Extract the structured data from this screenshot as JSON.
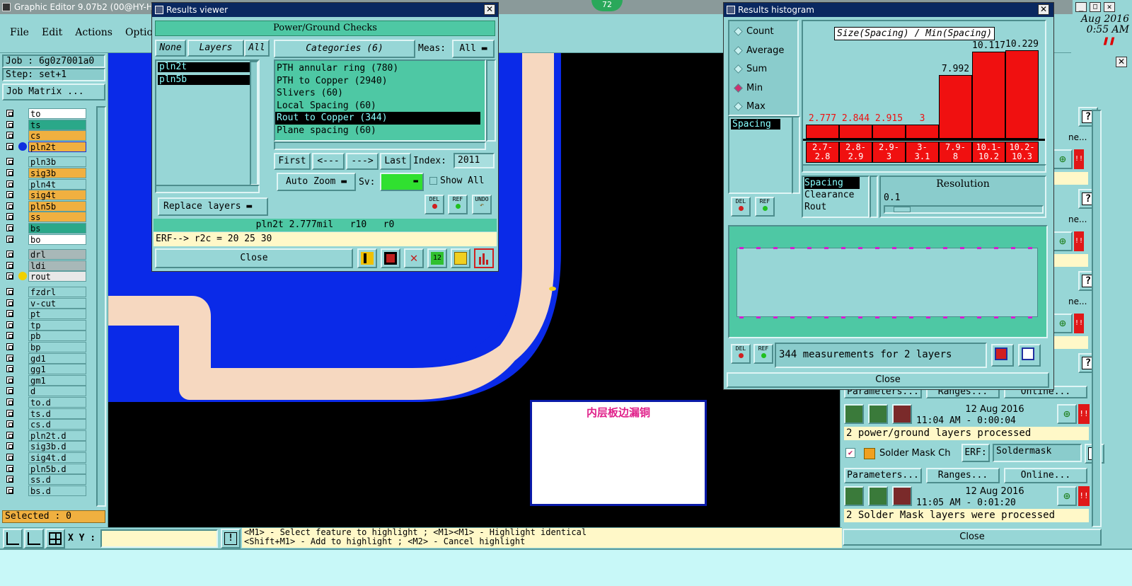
{
  "app": {
    "title": "Graphic Editor 9.07b2 (00@HY-HYC",
    "badge": "72",
    "clock": {
      "date": "Aug 2016",
      "time": "0:55 AM"
    }
  },
  "menu": {
    "items": [
      "File",
      "Edit",
      "Actions",
      "Options"
    ]
  },
  "job": {
    "label": "Job : 6g0z7001a0",
    "step": "Step: set+1",
    "matrix_button": "Job Matrix ...",
    "selected": "Selected : 0"
  },
  "layers": [
    {
      "name": "to",
      "color": "#ffffff"
    },
    {
      "name": "ts",
      "color": "#2aa889"
    },
    {
      "name": "cs",
      "color": "#f0b040"
    },
    {
      "name": "pln2t",
      "color": "#f0b040",
      "active": true
    },
    {
      "name": "pln3b",
      "color": "#97d6d6"
    },
    {
      "name": "sig3b",
      "color": "#f0b040"
    },
    {
      "name": "pln4t",
      "color": "#97d6d6"
    },
    {
      "name": "sig4t",
      "color": "#f0b040"
    },
    {
      "name": "pln5b",
      "color": "#f0b040"
    },
    {
      "name": "ss",
      "color": "#f0b040"
    },
    {
      "name": "bs",
      "color": "#2aa889"
    },
    {
      "name": "bo",
      "color": "#ffffff"
    },
    {
      "name": "drl",
      "color": "#a8b8b8"
    },
    {
      "name": "ldi",
      "color": "#a8b8b8"
    },
    {
      "name": "rout",
      "color": "#e8e8e8",
      "dot": true
    },
    {
      "name": "fzdrl",
      "color": "#97d6d6"
    },
    {
      "name": "v-cut",
      "color": "#97d6d6"
    },
    {
      "name": "pt",
      "color": "#97d6d6"
    },
    {
      "name": "tp",
      "color": "#97d6d6"
    },
    {
      "name": "pb",
      "color": "#97d6d6"
    },
    {
      "name": "bp",
      "color": "#97d6d6"
    },
    {
      "name": "gd1",
      "color": "#97d6d6"
    },
    {
      "name": "gg1",
      "color": "#97d6d6"
    },
    {
      "name": "gm1",
      "color": "#97d6d6"
    },
    {
      "name": "d",
      "color": "#97d6d6"
    },
    {
      "name": "to.d",
      "color": "#97d6d6"
    },
    {
      "name": "ts.d",
      "color": "#97d6d6"
    },
    {
      "name": "cs.d",
      "color": "#97d6d6"
    },
    {
      "name": "pln2t.d",
      "color": "#97d6d6"
    },
    {
      "name": "sig3b.d",
      "color": "#97d6d6"
    },
    {
      "name": "sig4t.d",
      "color": "#97d6d6"
    },
    {
      "name": "pln5b.d",
      "color": "#97d6d6"
    },
    {
      "name": "ss.d",
      "color": "#97d6d6"
    },
    {
      "name": "bs.d",
      "color": "#97d6d6"
    }
  ],
  "results_viewer": {
    "title": "Results viewer",
    "header": "Power/Ground Checks",
    "layers_toggle": {
      "none": "None",
      "layers": "Layers",
      "all": "All"
    },
    "layer_list": [
      "pln2t",
      "pln5b"
    ],
    "categories_label": "Categories (6)",
    "meas_label": "Meas:",
    "meas_value": "All",
    "categories": [
      "PTH annular ring (780)",
      "PTH to Copper (2940)",
      "Slivers (60)",
      "Local Spacing (60)",
      "Rout to Copper (344)",
      "Plane spacing (60)"
    ],
    "selected_category": "Rout to Copper (344)",
    "nav": {
      "first": "First",
      "prev": "<---",
      "next": "--->",
      "last": "Last",
      "index_label": "Index:",
      "index_value": "2011"
    },
    "auto_zoom": "Auto Zoom",
    "sv_label": "Sv:",
    "show_all": "Show All",
    "replace_layers": "Replace layers",
    "icon_labels": {
      "del": "DEL",
      "ref": "REF",
      "undo": "UNDO"
    },
    "status": "pln2t 2.777mil   r10   r0",
    "erf": "ERF--> r2c = 20 25 30",
    "close": "Close"
  },
  "histogram": {
    "title": "Results histogram",
    "chart_title": "Size(Spacing) / Min(Spacing)",
    "modes": [
      "Count",
      "Average",
      "Sum",
      "Min",
      "Max"
    ],
    "selected_mode": "Min",
    "list_item": "Spacing",
    "sub_list": [
      "Spacing",
      "Clearance",
      "Rout"
    ],
    "resolution_label": "Resolution",
    "resolution_value": "0.1",
    "measurements": "344 measurements for 2 layers",
    "close": "Close"
  },
  "chart_data": {
    "type": "bar",
    "title": "Size(Spacing) / Min(Spacing)",
    "categories": [
      "2.7-2.8",
      "2.8-2.9",
      "2.9-3",
      "3-3.1",
      "7.9-8",
      "10.1-10.2",
      "10.2-10.3"
    ],
    "category_lines": [
      [
        "2.7-",
        "2.8"
      ],
      [
        "2.8-",
        "2.9"
      ],
      [
        "2.9-",
        "3"
      ],
      [
        "3-",
        "3.1"
      ],
      [
        "7.9-",
        "8"
      ],
      [
        "10.1-",
        "10.2"
      ],
      [
        "10.2-",
        "10.3"
      ]
    ],
    "values": [
      2.777,
      2.844,
      2.915,
      3,
      7.992,
      10.117,
      10.229
    ],
    "value_labels": [
      "2.777",
      "2.844",
      "2.915",
      "3",
      "7.992",
      "10.117",
      "10.229"
    ],
    "ylim": [
      0,
      10.3
    ],
    "xlabel": "",
    "ylabel": ""
  },
  "canvas": {
    "annotation": "内层板边漏铜"
  },
  "checks": {
    "row1": {
      "buttons": [
        "Parameters...",
        "Ranges...",
        "Online..."
      ],
      "date": "12 Aug 2016",
      "time": "11:04 AM - 0:00:04",
      "message": "2 power/ground layers processed"
    },
    "row2": {
      "name": "Solder Mask Ch",
      "erf_label": "ERF:",
      "erf_value": "Soldermask",
      "buttons": [
        "Parameters...",
        "Ranges...",
        "Online..."
      ],
      "date": "12 Aug 2016",
      "time": "11:05 AM - 0:01:20",
      "message": "2 Solder Mask layers were processed"
    },
    "side_labels": [
      "ne...",
      "ne...",
      "ne..."
    ],
    "close": "Close"
  },
  "bottom": {
    "xy_label": "X Y :",
    "hint1": "<M1> - Select feature to highlight ; <M1><M1> - Highlight identical",
    "hint2": "<Shift+M1> - Add to highlight ; <M2> - Cancel highlight"
  }
}
